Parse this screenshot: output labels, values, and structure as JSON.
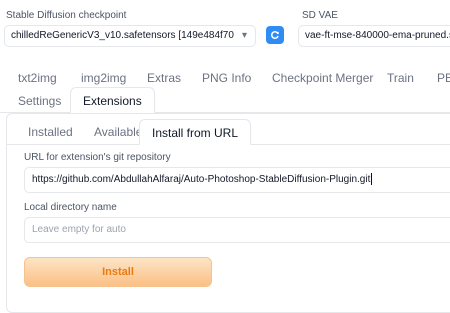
{
  "top": {
    "checkpoint_label": "Stable Diffusion checkpoint",
    "checkpoint_value": "chilledReGenericV3_v10.safetensors [149e484f70",
    "vae_label": "SD VAE",
    "vae_value": "vae-ft-mse-840000-ema-pruned.sa"
  },
  "main_tabs": [
    {
      "label": "txt2img"
    },
    {
      "label": "img2img"
    },
    {
      "label": "Extras"
    },
    {
      "label": "PNG Info"
    },
    {
      "label": "Checkpoint Merger"
    },
    {
      "label": "Train"
    },
    {
      "label": "PB"
    },
    {
      "label": "Settings"
    },
    {
      "label": "Extensions"
    }
  ],
  "ext_tabs": [
    {
      "label": "Installed"
    },
    {
      "label": "Available"
    },
    {
      "label": "Install from URL"
    }
  ],
  "form": {
    "url_label": "URL for extension's git repository",
    "url_value": "https://github.com/AbdullahAlfaraj/Auto-Photoshop-StableDiffusion-Plugin.git",
    "dir_label": "Local directory name",
    "dir_placeholder": "Leave empty for auto",
    "install_label": "Install"
  },
  "colors": {
    "accent": "#2f8cf4",
    "install_text": "#ea7a12"
  }
}
